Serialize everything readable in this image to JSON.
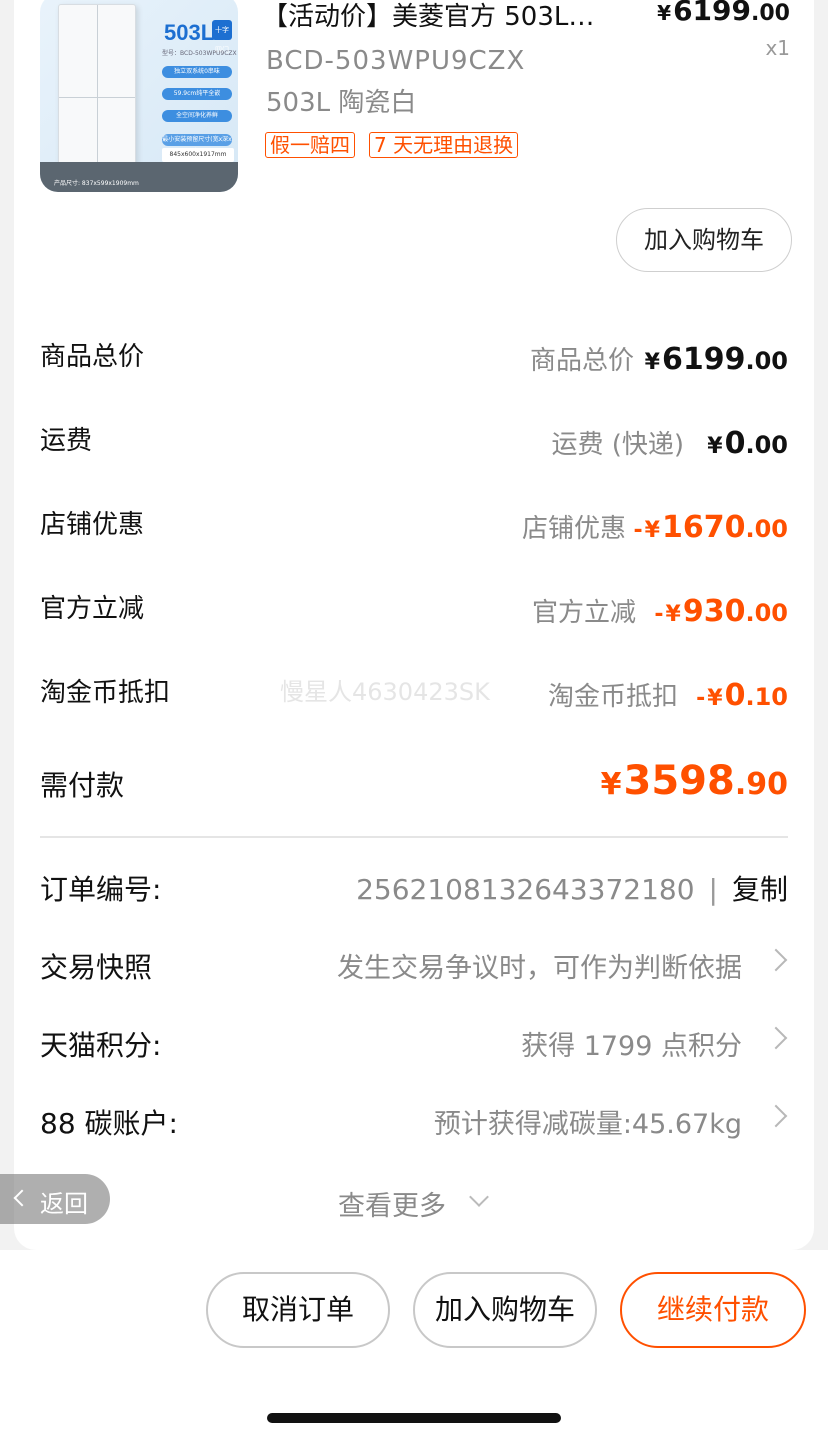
{
  "product": {
    "title": "【活动价】美菱官方 503L…",
    "price_symbol": "¥",
    "price_int": "6199",
    "price_dec": ".00",
    "quantity": "x1",
    "sku_line1": "BCD-503WPU9CZX",
    "sku_line2": "503L 陶瓷白",
    "tags": [
      "假一赔四",
      "7 天无理由退换"
    ],
    "thumb": {
      "capacity": "503L",
      "badge": "十字四门",
      "model": "型号：BCD-503WPU9CZX",
      "features": [
        "独立双系统0串味",
        "59.9cm纯平全嵌",
        "全空间净化养鲜",
        "最小安装预留尺寸(宽x深x高)"
      ],
      "install_dim": "845x600x1917mm",
      "product_size": "产品尺寸: 837x599x1909mm"
    },
    "add_cart_label": "加入购物车"
  },
  "summary": {
    "items": [
      {
        "label": "商品总价",
        "sub": "商品总价",
        "sign": "",
        "cur": "¥",
        "int": "6199",
        "dec": ".00",
        "accent": false
      },
      {
        "label": "运费",
        "sub": "运费 (快递)",
        "sign": "",
        "cur": "¥",
        "int": "0",
        "dec": ".00",
        "accent": false
      },
      {
        "label": "店铺优惠",
        "sub": "店铺优惠",
        "sign": "-",
        "cur": "¥",
        "int": "1670",
        "dec": ".00",
        "accent": true
      },
      {
        "label": "官方立减",
        "sub": "官方立减",
        "sign": "-",
        "cur": "¥",
        "int": "930",
        "dec": ".00",
        "accent": true
      },
      {
        "label": "淘金币抵扣",
        "sub": "淘金币抵扣",
        "sign": "-",
        "cur": "¥",
        "int": "0",
        "dec": ".10",
        "accent": true
      }
    ],
    "watermark": "慢星人4630423SK",
    "total": {
      "label": "需付款",
      "cur": "¥",
      "int": "3598",
      "dec": ".90"
    }
  },
  "info": {
    "order": {
      "label": "订单编号:",
      "number": "2562108132643372180",
      "separator": "|",
      "copy": "复制"
    },
    "snapshot": {
      "label": "交易快照",
      "text": "发生交易争议时，可作为判断依据"
    },
    "points": {
      "label": "天猫积分:",
      "text": "获得 1799 点积分"
    },
    "carbon": {
      "label": "88 碳账户:",
      "text": "预计获得减碳量:45.67kg"
    },
    "more": "查看更多"
  },
  "back_label": "返回",
  "actions": {
    "cancel": "取消订单",
    "add_cart": "加入购物车",
    "pay": "继续付款"
  },
  "colors": {
    "accent": "#ff5000",
    "muted": "#8a8a8a",
    "background": "#f2f2f2"
  }
}
